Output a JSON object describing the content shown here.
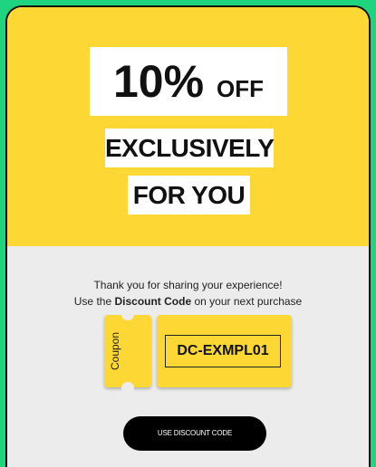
{
  "headline": {
    "percent": "10%",
    "off": "OFF",
    "line2": "EXCLUSIVELY",
    "line3": "FOR YOU"
  },
  "message": {
    "line1": "Thank you for sharing your experience!",
    "line2_prefix": "Use the",
    "line2_bold": "Discount Code",
    "line2_suffix": "on your next purchase"
  },
  "coupon": {
    "stub_label": "Coupon",
    "code": "DC-EXMPL01"
  },
  "cta": {
    "label": "USE DISCOUNT CODE"
  },
  "colors": {
    "background": "#1fd47f",
    "hero": "#fdd835",
    "panel": "#ececec",
    "button": "#000000"
  }
}
